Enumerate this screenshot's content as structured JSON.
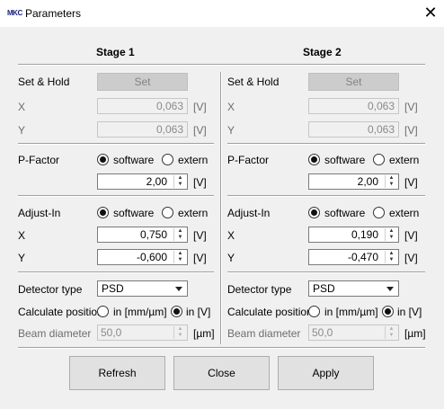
{
  "window": {
    "title": "Parameters",
    "logo": "MKC",
    "close_icon": "close-icon"
  },
  "stage1": {
    "header": "Stage 1",
    "set_hold_label": "Set & Hold",
    "set_button": "Set",
    "x_label": "X",
    "x_value": "0,063",
    "x_unit": "[V]",
    "y_label": "Y",
    "y_value": "0,063",
    "y_unit": "[V]",
    "pfactor_label": "P-Factor",
    "pfactor_software": "software",
    "pfactor_extern": "extern",
    "pfactor_selected": "software",
    "pfactor_value": "2,00",
    "pfactor_unit": "[V]",
    "adjust_label": "Adjust-In",
    "adjust_software": "software",
    "adjust_extern": "extern",
    "adjust_selected": "software",
    "adjust_x_label": "X",
    "adjust_x_value": "0,750",
    "adjust_x_unit": "[V]",
    "adjust_y_label": "Y",
    "adjust_y_value": "-0,600",
    "adjust_y_unit": "[V]",
    "detector_label": "Detector type",
    "detector_value": "PSD",
    "calc_label": "Calculate position",
    "calc_mm": "in [mm/µm]",
    "calc_v": "in [V]",
    "calc_selected": "in [V]",
    "beam_label": "Beam diameter",
    "beam_value": "50,0",
    "beam_unit": "[µm]"
  },
  "stage2": {
    "header": "Stage 2",
    "set_hold_label": "Set & Hold",
    "set_button": "Set",
    "x_label": "X",
    "x_value": "0,063",
    "x_unit": "[V]",
    "y_label": "Y",
    "y_value": "0,063",
    "y_unit": "[V]",
    "pfactor_label": "P-Factor",
    "pfactor_software": "software",
    "pfactor_extern": "extern",
    "pfactor_selected": "software",
    "pfactor_value": "2,00",
    "pfactor_unit": "[V]",
    "adjust_label": "Adjust-In",
    "adjust_software": "software",
    "adjust_extern": "extern",
    "adjust_selected": "software",
    "adjust_x_label": "X",
    "adjust_x_value": "0,190",
    "adjust_x_unit": "[V]",
    "adjust_y_label": "Y",
    "adjust_y_value": "-0,470",
    "adjust_y_unit": "[V]",
    "detector_label": "Detector type",
    "detector_value": "PSD",
    "calc_label": "Calculate position",
    "calc_mm": "in [mm/µm]",
    "calc_v": "in [V]",
    "calc_selected": "in [V]",
    "beam_label": "Beam diameter",
    "beam_value": "50,0",
    "beam_unit": "[µm]"
  },
  "buttons": {
    "refresh": "Refresh",
    "close": "Close",
    "apply": "Apply"
  }
}
